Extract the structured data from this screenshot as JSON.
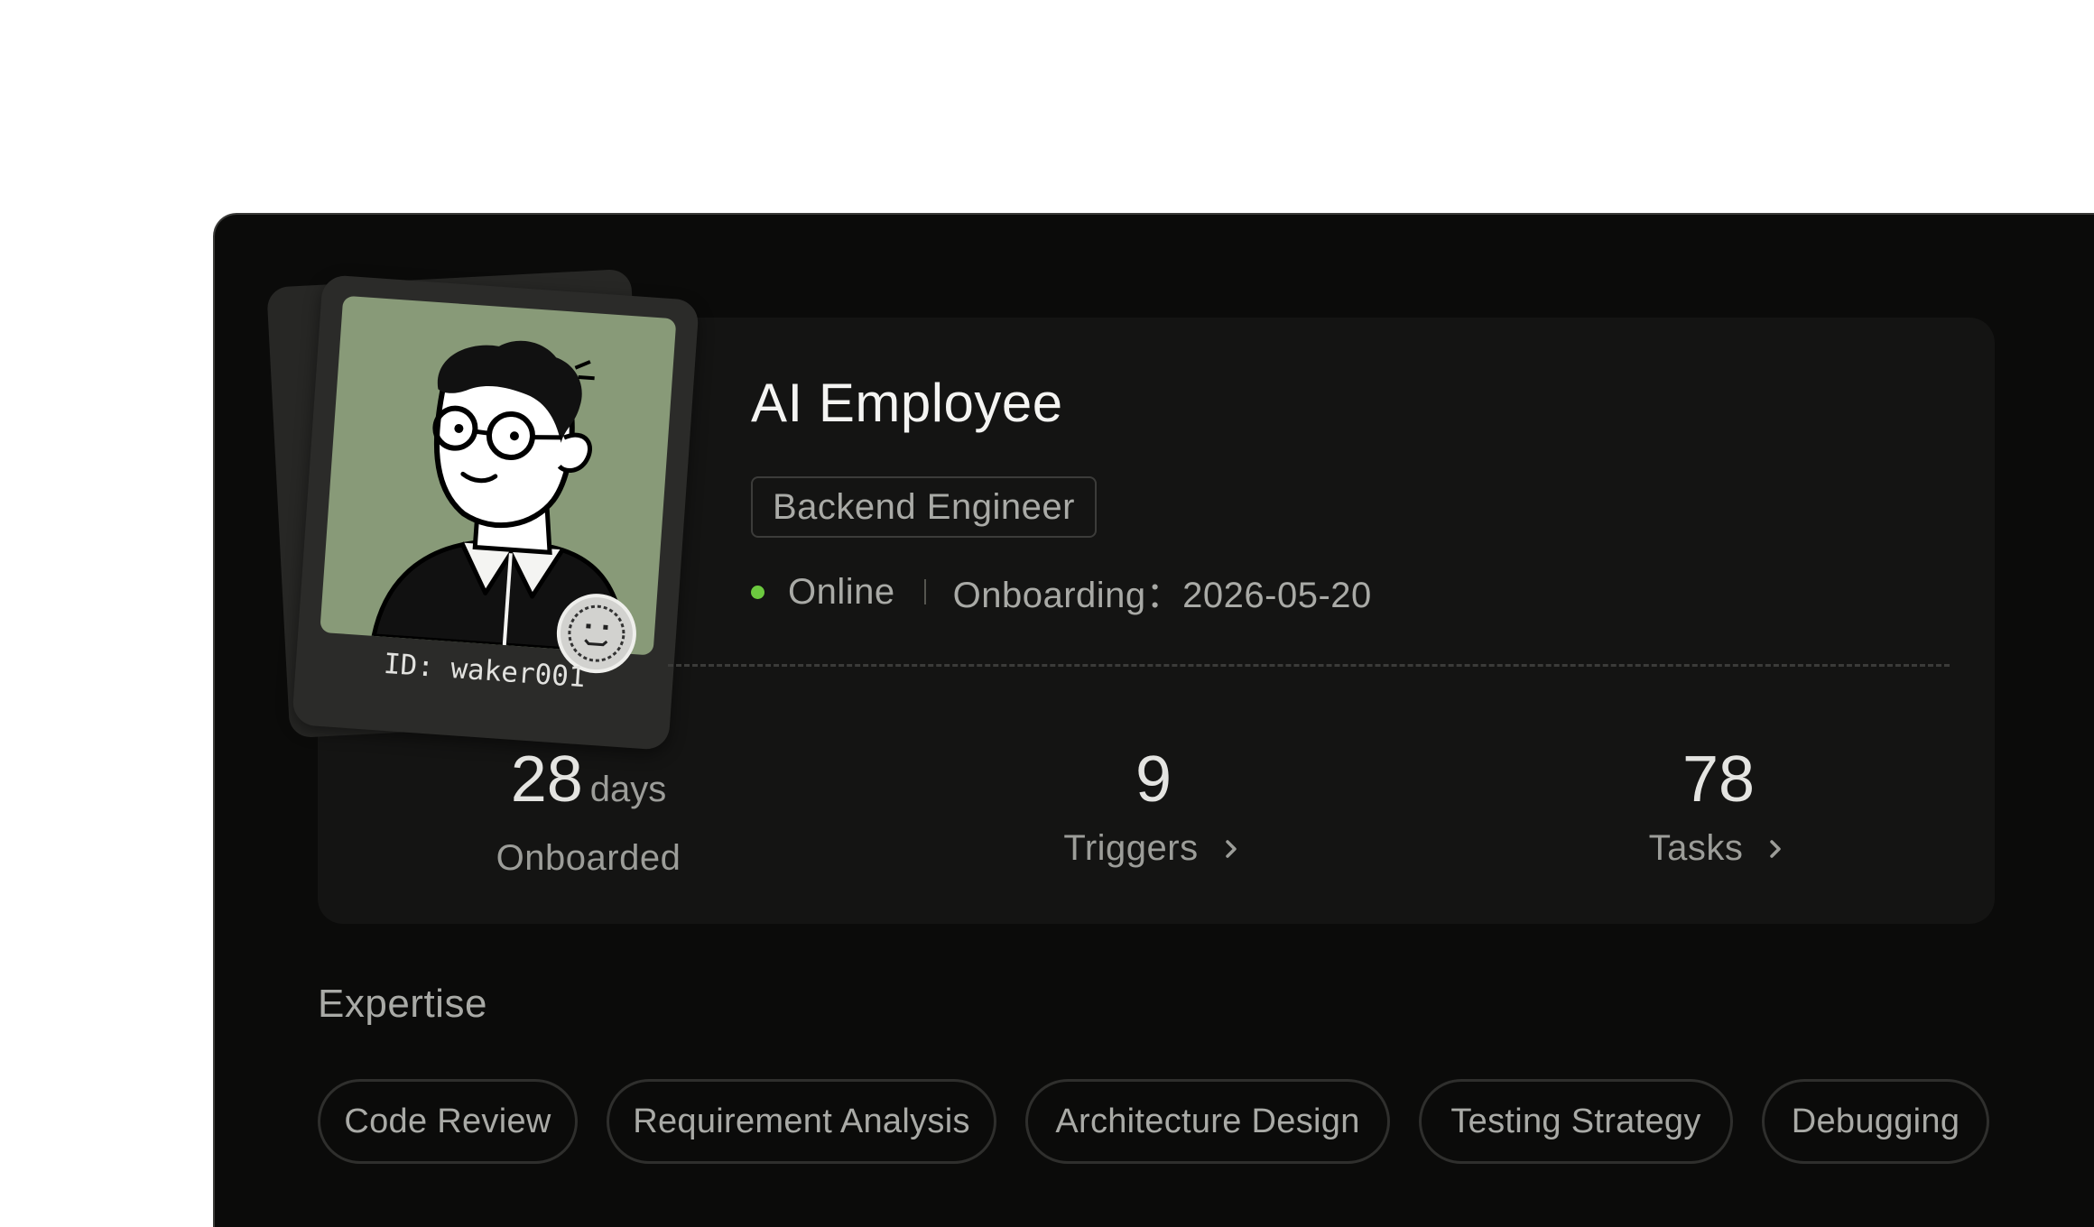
{
  "profile": {
    "name": "AI Employee",
    "role": "Backend Engineer",
    "status": "Online",
    "onboarding": "Onboarding：2026-05-20",
    "card_id": "ID: waker001"
  },
  "stats": {
    "onboarded_value": "28",
    "onboarded_unit": "days",
    "onboarded_label": "Onboarded",
    "triggers_value": "9",
    "triggers_label": "Triggers",
    "tasks_value": "78",
    "tasks_label": "Tasks"
  },
  "expertise": {
    "title": "Expertise",
    "items": [
      "Code Review",
      "Requirement Analysis",
      "Architecture Design",
      "Testing Strategy",
      "Debugging"
    ]
  },
  "colors": {
    "background": "#0b0b0a",
    "card": "#141413",
    "online": "#6cc93f",
    "photo_bg": "#889a78"
  }
}
